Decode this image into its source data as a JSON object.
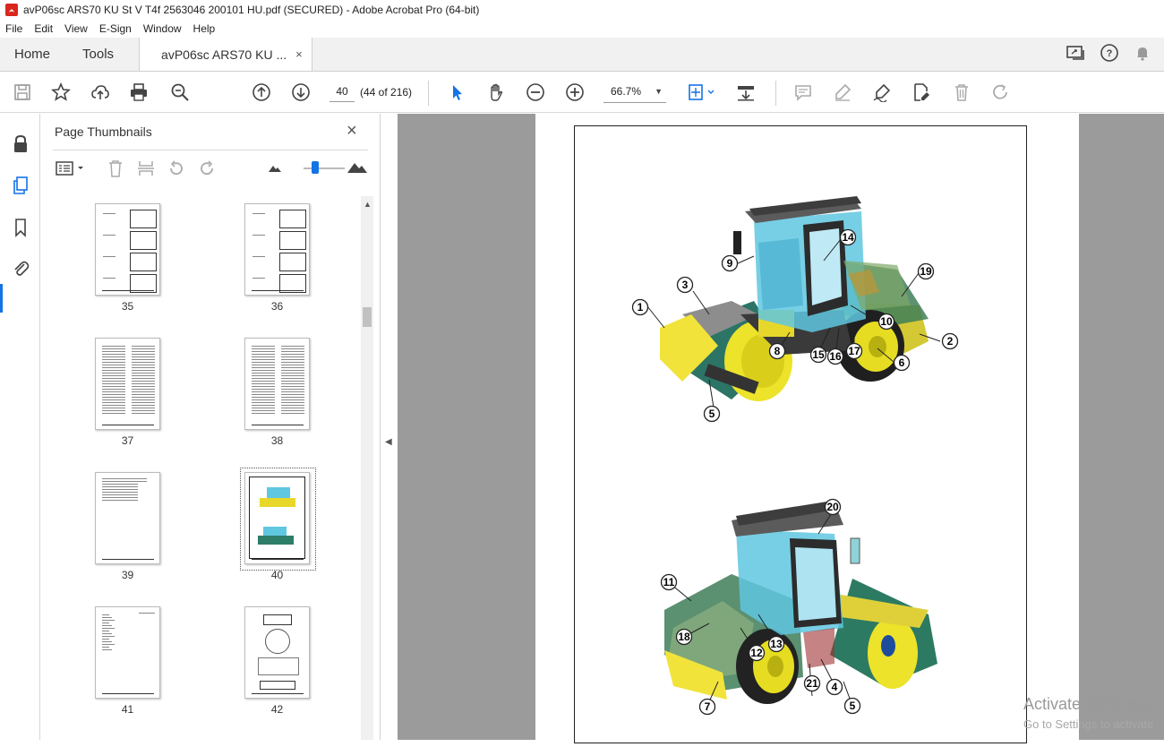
{
  "window": {
    "title": "avP06sc ARS70 KU St V T4f 2563046 200101 HU.pdf (SECURED) - Adobe Acrobat Pro (64-bit)"
  },
  "menu": [
    "File",
    "Edit",
    "View",
    "E-Sign",
    "Window",
    "Help"
  ],
  "tabs": {
    "home": "Home",
    "tools": "Tools",
    "document": "avP06sc ARS70 KU ...",
    "close": "×"
  },
  "toolbar": {
    "page_value": "40",
    "page_count": "(44 of 216)",
    "zoom": "66.7%"
  },
  "thumbnails_panel": {
    "title": "Page Thumbnails",
    "close": "×",
    "pages": [
      {
        "label": "35",
        "type": "figures"
      },
      {
        "label": "36",
        "type": "figures"
      },
      {
        "label": "37",
        "type": "text2col"
      },
      {
        "label": "38",
        "type": "text2col"
      },
      {
        "label": "39",
        "type": "textshort"
      },
      {
        "label": "40",
        "type": "roller",
        "selected": true
      },
      {
        "label": "41",
        "type": "list"
      },
      {
        "label": "42",
        "type": "diagram"
      }
    ]
  },
  "document": {
    "callouts_top": [
      "1",
      "2",
      "3",
      "5",
      "6",
      "8",
      "9",
      "10",
      "14",
      "15",
      "16",
      "17",
      "19"
    ],
    "callouts_bottom": [
      "4",
      "5",
      "7",
      "11",
      "12",
      "13",
      "18",
      "20",
      "21"
    ]
  },
  "watermark": {
    "line1": "Activate Windows",
    "line2": "Go to Settings to activate"
  },
  "colors": {
    "accent": "#1473e6",
    "body_yellow": "#e8d72b",
    "body_green": "#2e7d68",
    "glass": "#5fc7e0",
    "roof": "#555555"
  }
}
